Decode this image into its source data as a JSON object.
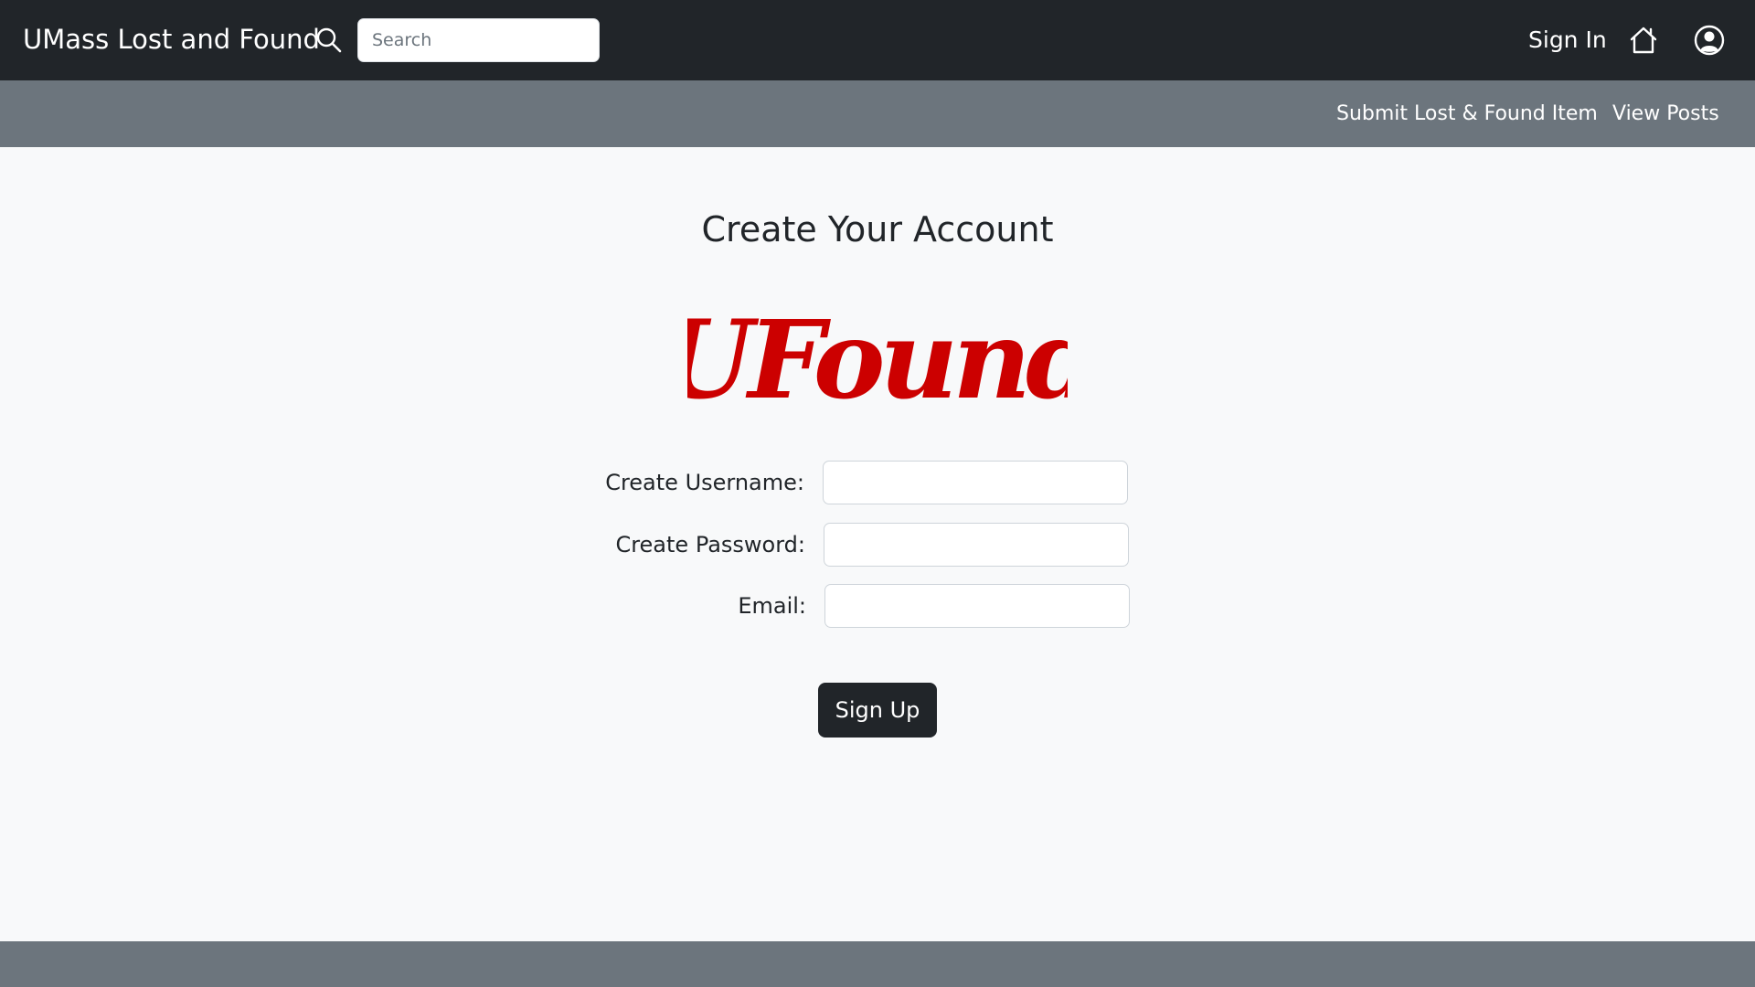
{
  "header": {
    "brand": "UMass Lost and Found",
    "search_icon": "search-icon",
    "search_placeholder": "Search",
    "search_value": "",
    "signin_label": "Sign In",
    "home_icon": "home-icon",
    "profile_icon": "user-circle-icon",
    "background": "#212529"
  },
  "subnav": {
    "items": [
      {
        "label": "Submit Lost & Found Item"
      },
      {
        "label": "View Posts"
      }
    ],
    "background": "#6c757d"
  },
  "main": {
    "title": "Create Your Account",
    "logo_text": "UFound",
    "logo_color": "#cc0000",
    "form": {
      "fields": [
        {
          "label": "Create Username:",
          "value": ""
        },
        {
          "label": "Create Password:",
          "value": ""
        },
        {
          "label": "Email:",
          "value": ""
        }
      ],
      "submit_label": "Sign Up"
    }
  },
  "footer": {
    "background": "#6c757d"
  }
}
